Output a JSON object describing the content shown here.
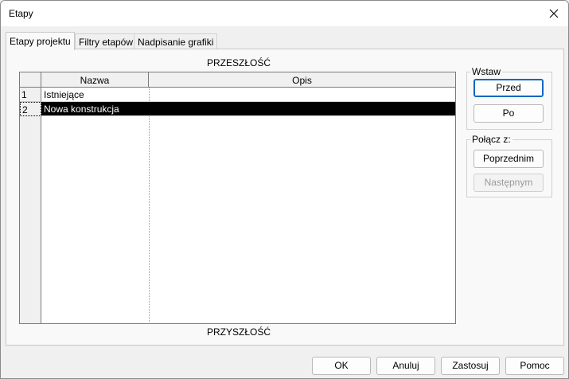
{
  "window": {
    "title": "Etapy"
  },
  "tabs": [
    {
      "label": "Etapy projektu",
      "active": true
    },
    {
      "label": "Filtry etapów",
      "active": false
    },
    {
      "label": "Nadpisanie grafiki",
      "active": false
    }
  ],
  "grid": {
    "top_caption": "PRZESZŁOŚĆ",
    "bottom_caption": "PRZYSZŁOŚĆ",
    "columns": [
      "Nazwa",
      "Opis"
    ],
    "rows": [
      {
        "num": "1",
        "name": "Istniejące",
        "description": "",
        "selected": false
      },
      {
        "num": "2",
        "name": "Nowa konstrukcja",
        "description": "",
        "selected": true
      }
    ]
  },
  "insert_group": {
    "label": "Wstaw",
    "before": "Przed",
    "after": "Po"
  },
  "merge_group": {
    "label": "Połącz z:",
    "previous": "Poprzednim",
    "next": "Następnym"
  },
  "footer": {
    "ok": "OK",
    "cancel": "Anuluj",
    "apply": "Zastosuj",
    "help": "Pomoc"
  },
  "colors": {
    "accent": "#0067c0",
    "selection": "#000000"
  }
}
